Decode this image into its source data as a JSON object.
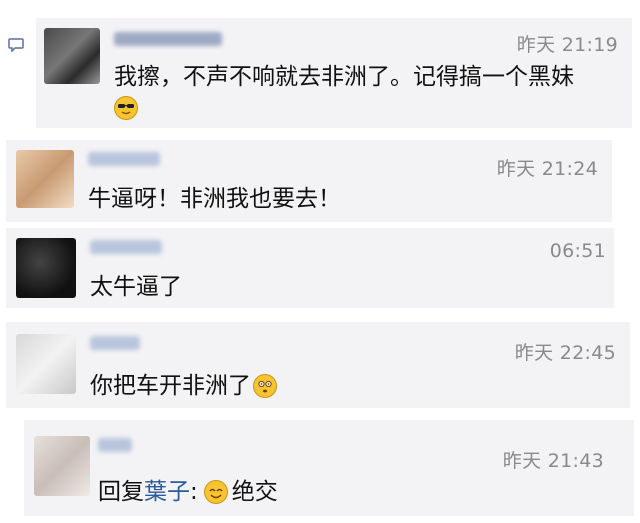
{
  "comments": [
    {
      "time": "昨天 21:19",
      "text": "我擦，不声不响就去非洲了。记得搞一个黑妹"
    },
    {
      "time": "昨天 21:24",
      "text": "牛逼呀！非洲我也要去！"
    },
    {
      "time": "06:51",
      "text": "太牛逼了"
    },
    {
      "time": "昨天 22:45",
      "text": "你把车开非洲了"
    },
    {
      "time": "昨天 21:43",
      "reply_prefix": "回复",
      "reply_to": "葉子",
      "reply_colon": ":",
      "text": "绝交"
    }
  ],
  "icons": {
    "comment_indicator": "speech-bubble-icon",
    "emojis": [
      "sunglasses-emoji-icon",
      "dizzy-emoji-icon",
      "smile-emoji-icon"
    ]
  },
  "colors": {
    "background": "#f3f3f5",
    "mention": "#2b5a9d",
    "timestamp": "#8a8a8a"
  }
}
